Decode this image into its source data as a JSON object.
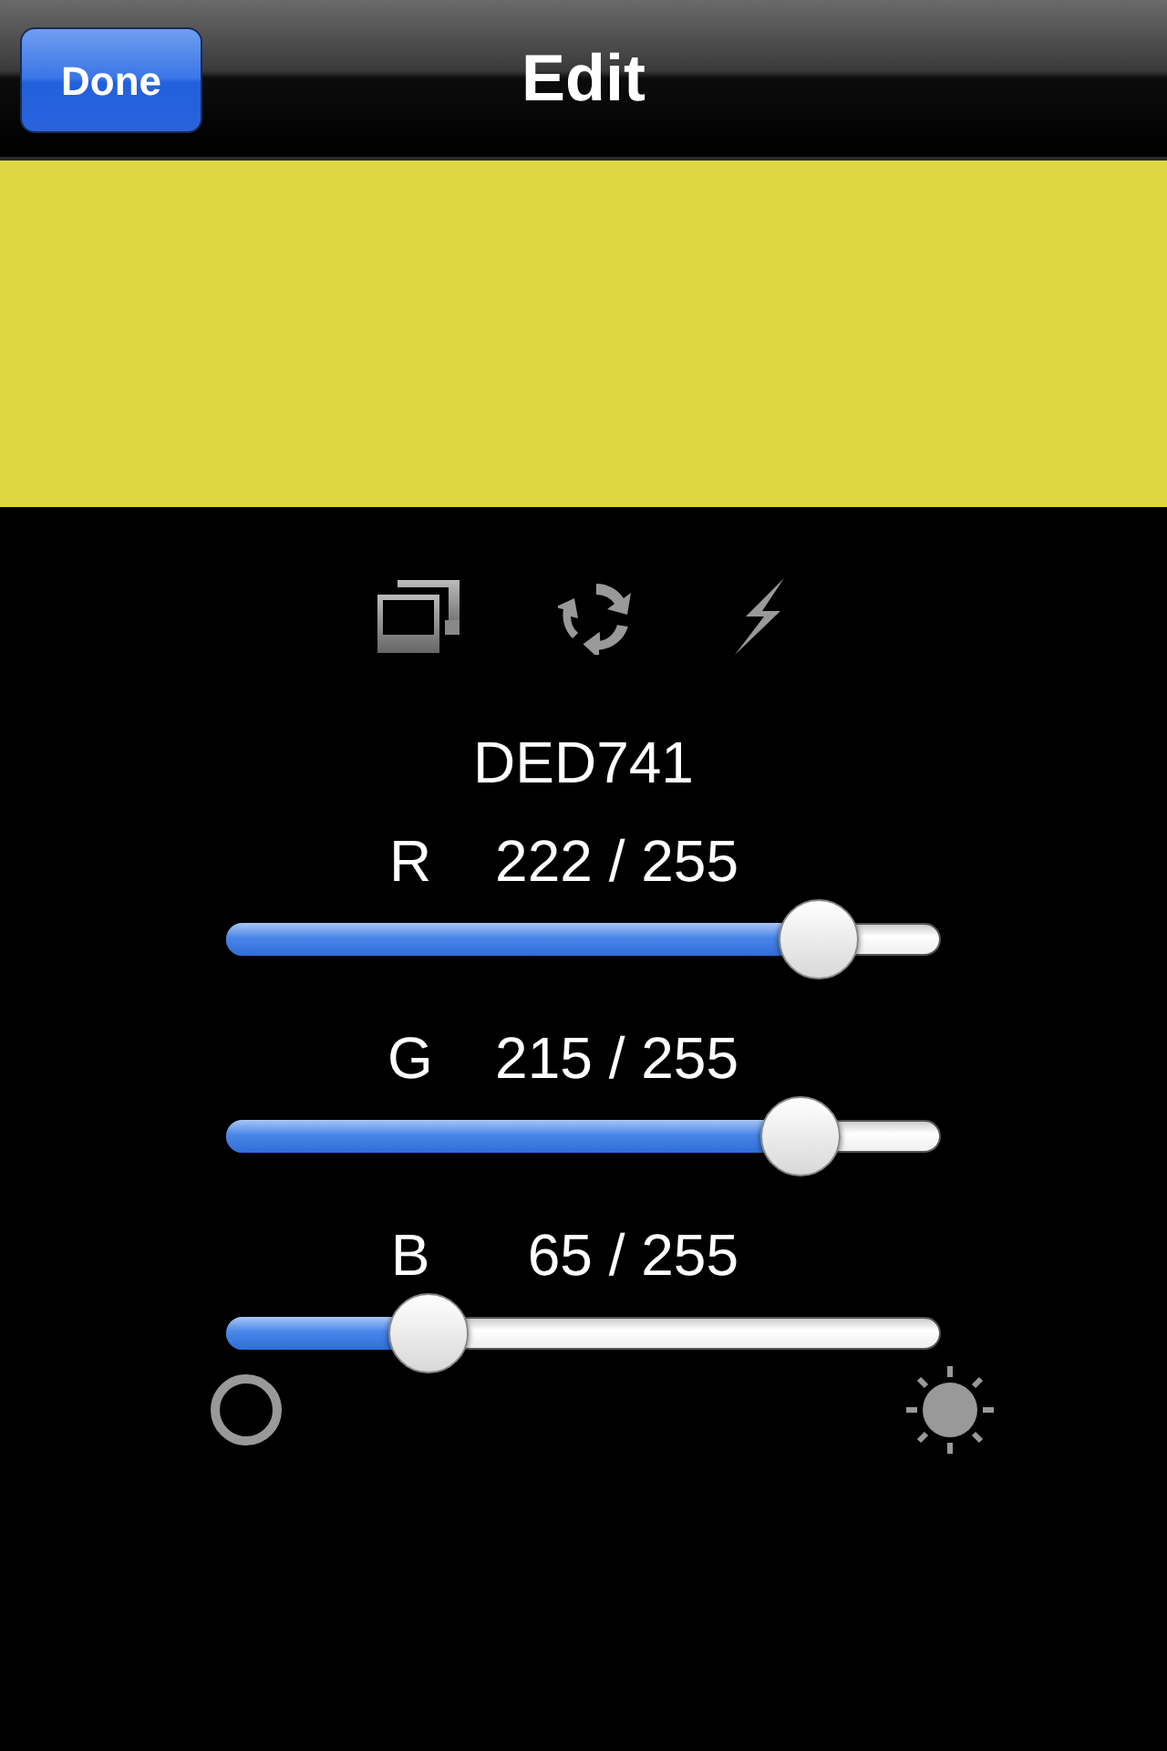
{
  "navbar": {
    "done_button": "Done",
    "title": "Edit"
  },
  "preview": {
    "color": "#ded741"
  },
  "hex": "DED741",
  "channels": [
    {
      "label": "R",
      "reading": "222 / 255",
      "level": 0.871
    },
    {
      "label": "G",
      "reading": "215 / 255",
      "level": 0.843
    },
    {
      "label": "B",
      "reading": "65 / 255",
      "level": 0.255
    }
  ]
}
